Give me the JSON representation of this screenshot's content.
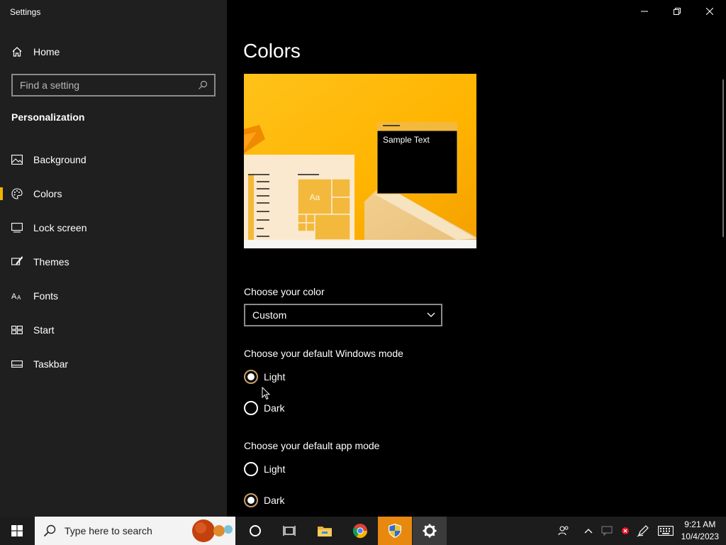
{
  "app": {
    "title": "Settings"
  },
  "sidebar": {
    "home_label": "Home",
    "search_placeholder": "Find a setting",
    "section_title": "Personalization",
    "items": [
      {
        "label": "Background",
        "icon": "image-icon"
      },
      {
        "label": "Colors",
        "icon": "palette-icon",
        "selected": true
      },
      {
        "label": "Lock screen",
        "icon": "lock-screen-icon"
      },
      {
        "label": "Themes",
        "icon": "brush-icon"
      },
      {
        "label": "Fonts",
        "icon": "fonts-icon"
      },
      {
        "label": "Start",
        "icon": "start-icon"
      },
      {
        "label": "Taskbar",
        "icon": "taskbar-icon"
      }
    ]
  },
  "main": {
    "title": "Colors",
    "preview": {
      "sample_text": "Sample Text",
      "tile_text": "Aa"
    },
    "choose_color": {
      "label": "Choose your color",
      "value": "Custom"
    },
    "windows_mode": {
      "label": "Choose your default Windows mode",
      "options": [
        {
          "label": "Light",
          "selected": true
        },
        {
          "label": "Dark",
          "selected": false
        }
      ]
    },
    "app_mode": {
      "label": "Choose your default app mode",
      "options": [
        {
          "label": "Light",
          "selected": false
        },
        {
          "label": "Dark",
          "selected": true
        }
      ]
    }
  },
  "taskbar": {
    "search_placeholder": "Type here to search",
    "time": "9:21 AM",
    "date": "10/4/2023"
  },
  "colors": {
    "accent": "#f0b400",
    "sidebar_bg": "#1f1f1f",
    "main_bg": "#000000",
    "taskbar_bg": "#1c1c1c"
  }
}
